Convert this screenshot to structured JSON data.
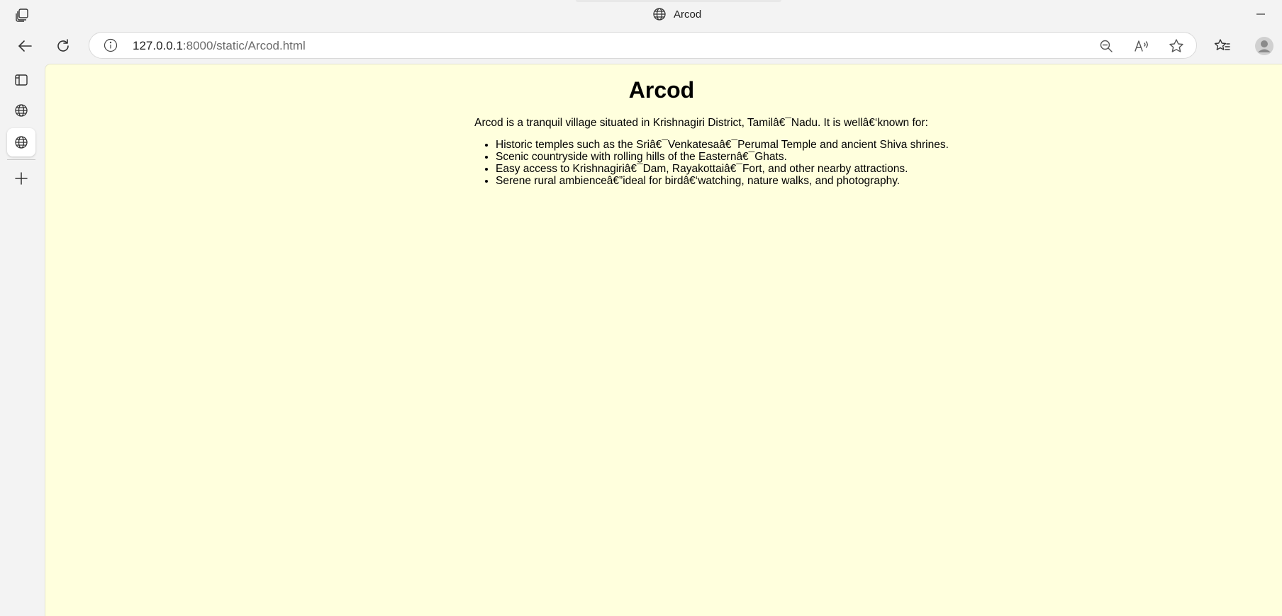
{
  "window": {
    "title": "Arcod"
  },
  "toolbar": {
    "url_host": "127.0.0.1",
    "url_rest": ":8000/static/Arcod.html"
  },
  "page": {
    "heading": "Arcod",
    "intro": "Arcod is a tranquil village situated in Krishnagiri District, Tamilâ€¯Nadu. It is wellâ€‘known for:",
    "bullets": [
      "Historic temples such as the Sriâ€¯Venkatesaâ€¯Perumal Temple and ancient Shiva shrines.",
      "Scenic countryside with rolling hills of the Easternâ€¯Ghats.",
      "Easy access to Krishnagiriâ€¯Dam, Rayakottaiâ€¯Fort, and other nearby attractions.",
      "Serene rural ambienceâ€”ideal for birdâ€‘watching, nature walks, and photography."
    ]
  },
  "icons": {
    "apps": "workspaces-icon",
    "globe": "globe-icon",
    "minimize": "minimize-icon",
    "back": "back-arrow-icon",
    "reload": "reload-icon",
    "info": "info-icon",
    "zoom": "zoom-out-icon",
    "read_aloud": "read-aloud-icon",
    "favorite": "star-icon",
    "favorites_list": "favorites-icon",
    "profile": "profile-icon",
    "tabs": "vertical-tabs-icon",
    "add": "plus-icon"
  },
  "colors": {
    "page_background": "#ffffdd",
    "chrome_background": "#f3f3f3"
  }
}
